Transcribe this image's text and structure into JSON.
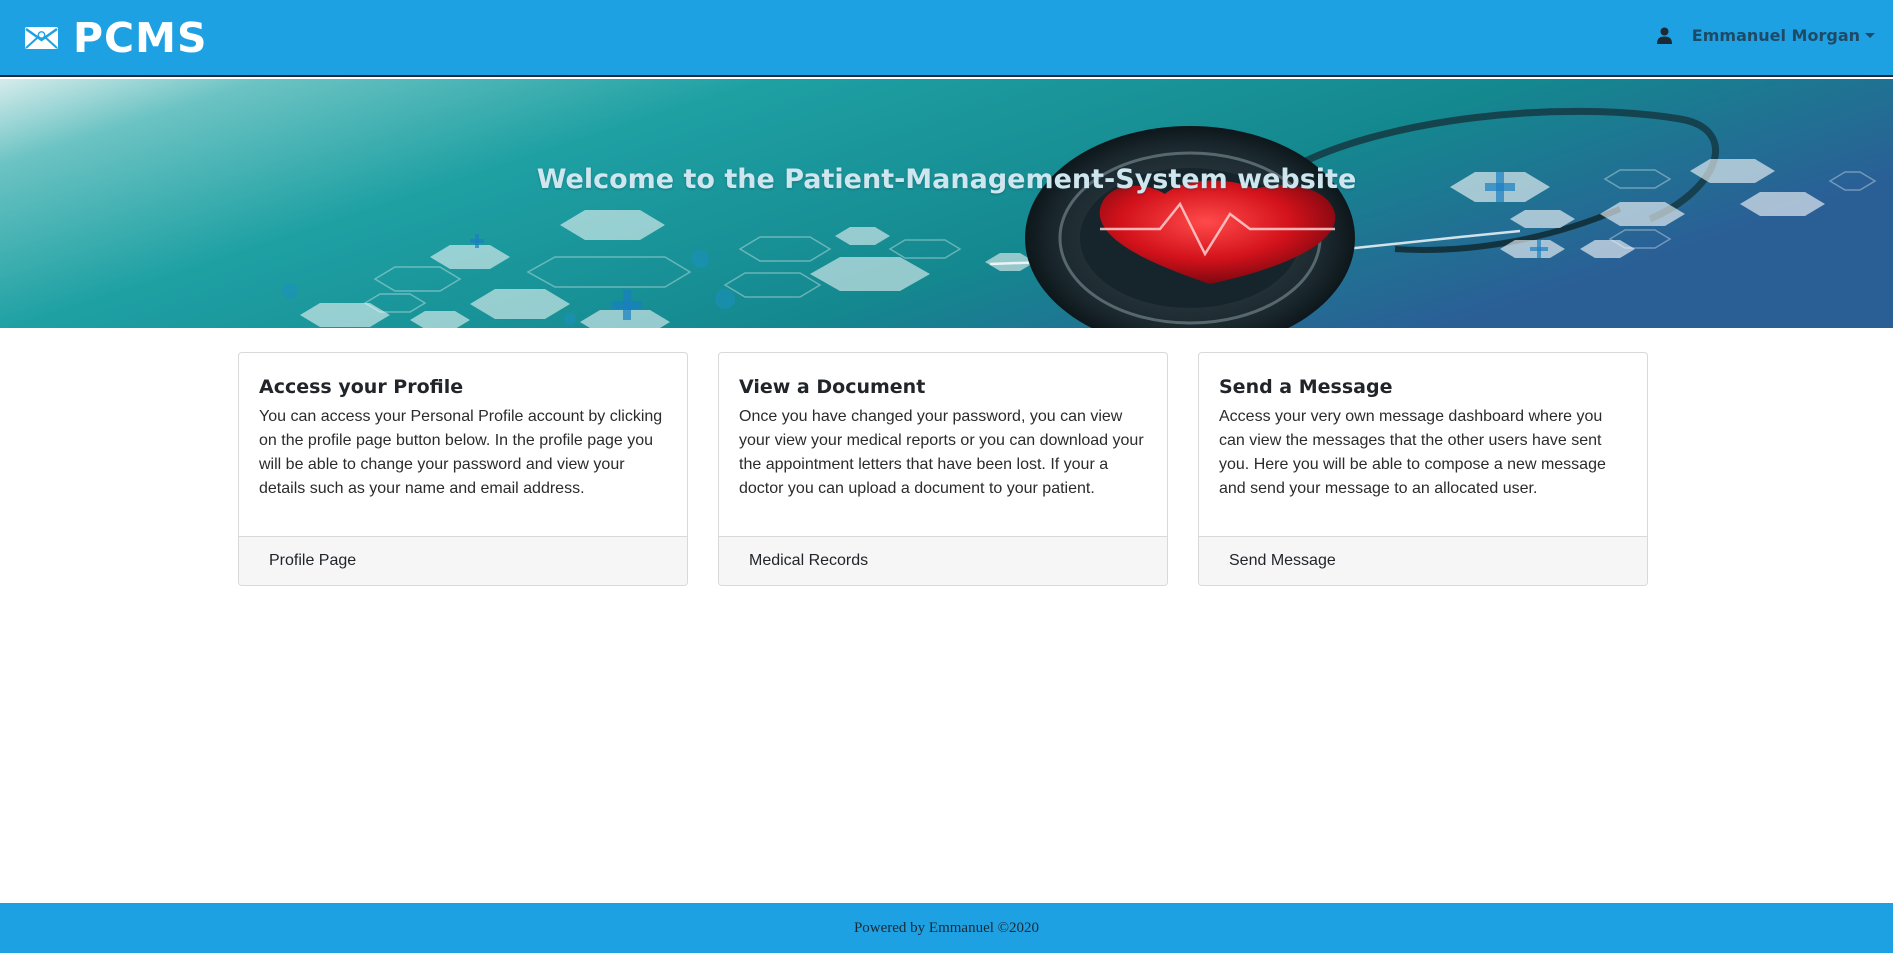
{
  "navbar": {
    "brand": "PCMS",
    "brand_icon": "envelope-icon",
    "user_icon": "user-icon",
    "user_name": "Emmanuel Morgan",
    "background": "#1ea1e3"
  },
  "hero": {
    "title": "Welcome to the Patient-Management-System website"
  },
  "cards": [
    {
      "title": "Access your Profile",
      "text": "You can access your Personal Profile account by clicking on the profile page button below. In the profile page you will be able to change your password and view your details such as your name and email address.",
      "link": "Profile Page"
    },
    {
      "title": "View a Document",
      "text": "Once you have changed your password, you can view your view your medical reports or you can download your the appointment letters that have been lost. If your a doctor you can upload a document to your patient.",
      "link": "Medical Records"
    },
    {
      "title": "Send a Message",
      "text": "Access your very own message dashboard where you can view the messages that the other users have sent you. Here you will be able to compose a new message and send your message to an allocated user.",
      "link": "Send Message"
    }
  ],
  "footer": {
    "text": "Powered by Emmanuel ©2020"
  }
}
